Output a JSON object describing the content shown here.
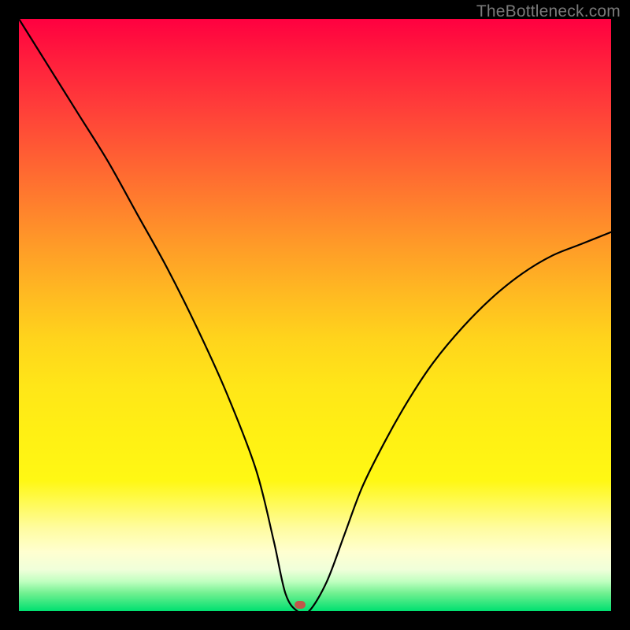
{
  "watermark": "TheBottleneck.com",
  "marker": {
    "x_percent": 47.5,
    "y_percent": 99.0
  },
  "colors": {
    "frame": "#000000",
    "marker": "#c0574a",
    "curve": "#000000",
    "watermark": "#7a7a7a"
  },
  "chart_data": {
    "type": "line",
    "title": "",
    "xlabel": "",
    "ylabel": "",
    "xlim": [
      0,
      100
    ],
    "ylim": [
      0,
      100
    ],
    "annotations": [
      "TheBottleneck.com"
    ],
    "legend": false,
    "grid": false,
    "series": [
      {
        "name": "bottleneck-curve",
        "x": [
          0,
          5,
          10,
          15,
          20,
          25,
          30,
          35,
          40,
          43,
          45,
          47,
          49,
          52,
          55,
          58,
          62,
          66,
          70,
          75,
          80,
          85,
          90,
          95,
          100
        ],
        "y": [
          100,
          92,
          84,
          76,
          67,
          58,
          48,
          37,
          24,
          12,
          3,
          0,
          0,
          5,
          13,
          21,
          29,
          36,
          42,
          48,
          53,
          57,
          60,
          62,
          64
        ]
      }
    ],
    "marker_point": {
      "x": 47.5,
      "y": 0
    },
    "background_gradient": {
      "orientation": "vertical",
      "stops": [
        {
          "pos": 0.0,
          "color": "#ff0040"
        },
        {
          "pos": 0.5,
          "color": "#ffd41c"
        },
        {
          "pos": 0.9,
          "color": "#ffffd0"
        },
        {
          "pos": 1.0,
          "color": "#00e070"
        }
      ]
    }
  }
}
